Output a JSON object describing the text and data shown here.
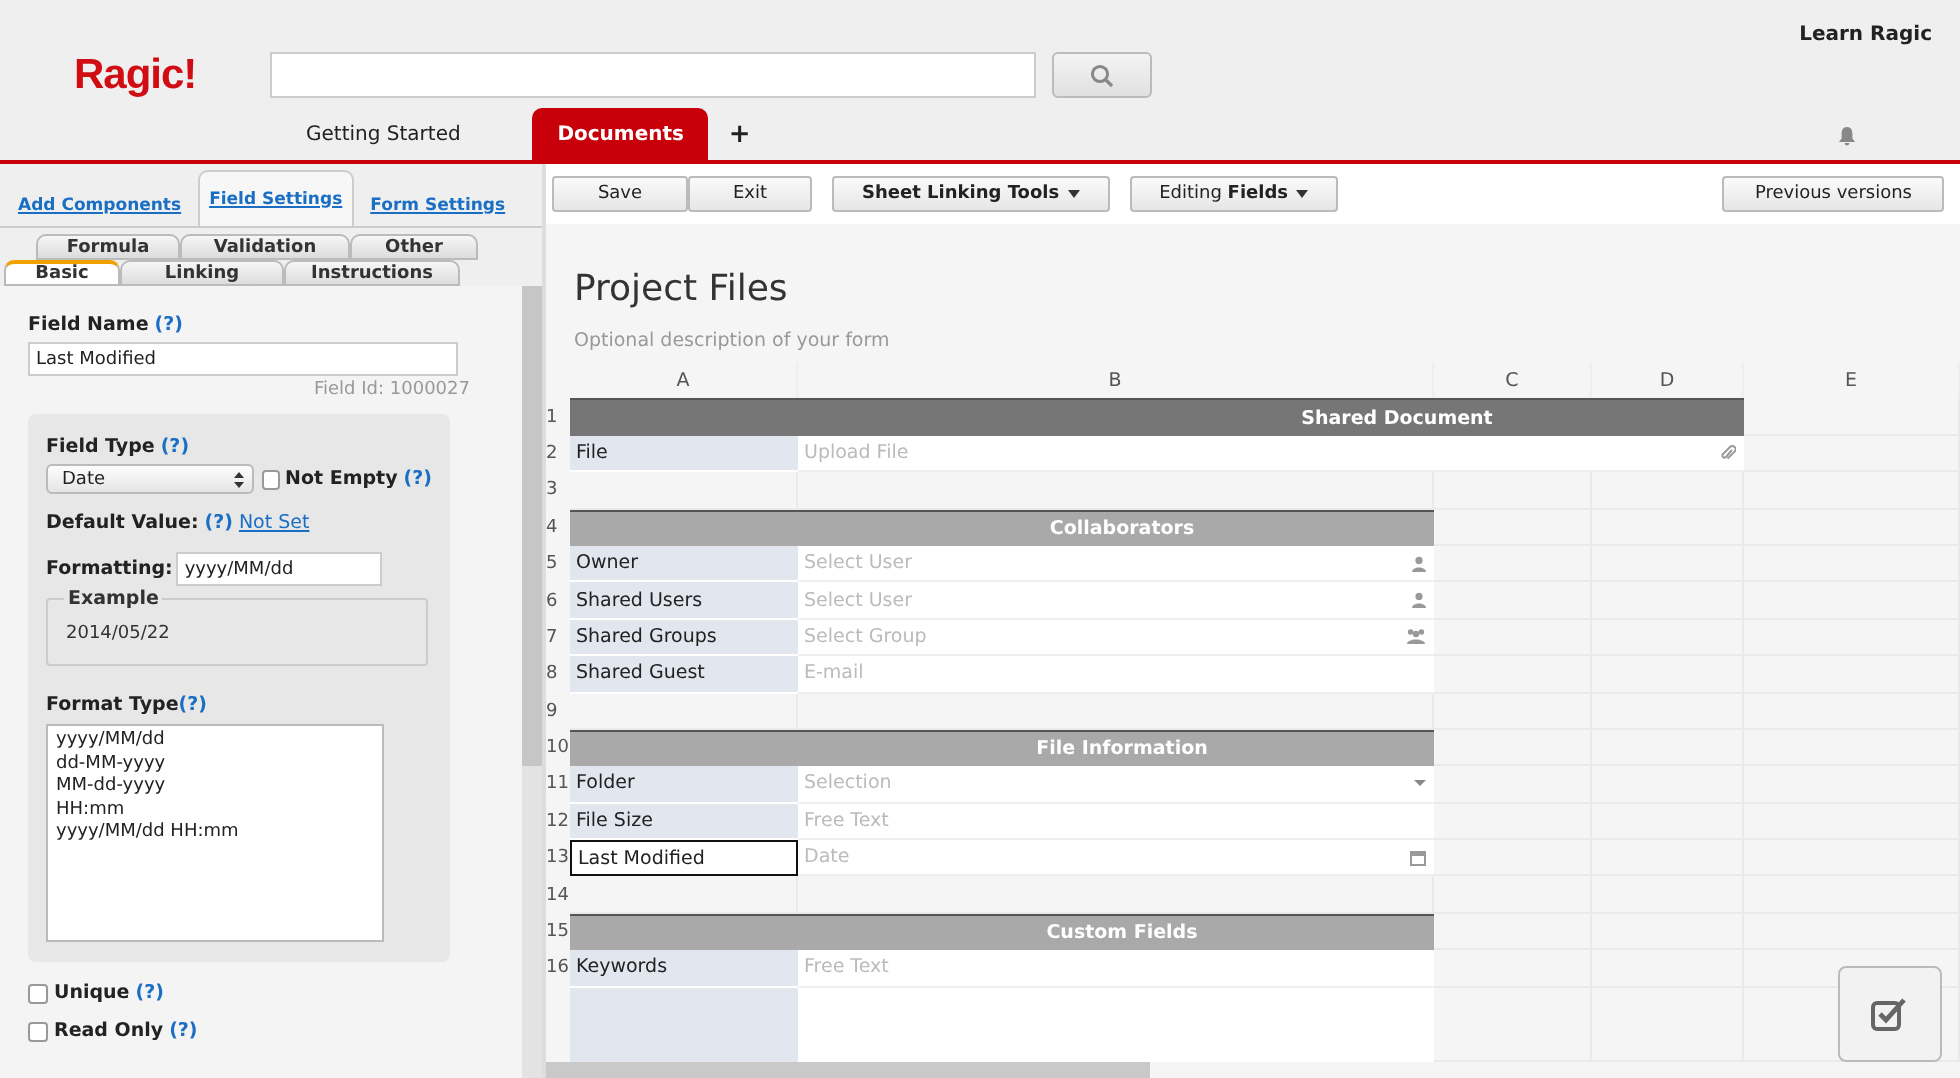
{
  "header": {
    "logo": "Ragic!",
    "learn_link": "Learn Ragic",
    "tabs": [
      {
        "label": "Getting Started",
        "selected": false
      },
      {
        "label": "Documents",
        "selected": true
      }
    ],
    "add_tab": "+"
  },
  "left_panel": {
    "tabs": [
      {
        "label": "Add Components",
        "selected": false
      },
      {
        "label": "Field Settings",
        "selected": true
      },
      {
        "label": "Form Settings",
        "selected": false
      }
    ],
    "subtabs_back": [
      {
        "label": "Formula",
        "selected": false
      },
      {
        "label": "Validation",
        "selected": false
      },
      {
        "label": "Other",
        "selected": false
      }
    ],
    "subtabs_front": [
      {
        "label": "Basic",
        "selected": true
      },
      {
        "label": "Linking",
        "selected": false
      },
      {
        "label": "Instructions",
        "selected": false
      }
    ],
    "field_name_label": "Field Name",
    "help": "(?)",
    "field_name": "Last Modified",
    "field_id": "Field Id: 1000027",
    "field_type_label": "Field Type",
    "field_type": "Date",
    "not_empty": {
      "label": "Not Empty",
      "checked": false
    },
    "default_value_label": "Default Value:",
    "default_value": "Not Set",
    "formatting_label": "Formatting:",
    "formatting": "yyyy/MM/dd",
    "example_label": "Example",
    "example": "2014/05/22",
    "format_type_label": "Format Type",
    "format_types": [
      "yyyy/MM/dd",
      "dd-MM-yyyy",
      "MM-dd-yyyy",
      "HH:mm",
      "yyyy/MM/dd HH:mm"
    ],
    "options": [
      {
        "label": "Unique",
        "checked": false
      },
      {
        "label": "Read Only",
        "checked": false
      }
    ]
  },
  "toolbar": {
    "buttons": [
      {
        "label": "Save",
        "kind": "plain"
      },
      {
        "label": "Exit",
        "kind": "plain"
      },
      {
        "label": "Sheet Linking Tools",
        "kind": "menu"
      },
      {
        "label": "Editing **Fields**",
        "kind": "menu"
      }
    ],
    "history": "Previous versions"
  },
  "form": {
    "title": "Project Files",
    "description": "Optional description of your form",
    "columns": [
      "A",
      "B",
      "C",
      "D",
      "E"
    ],
    "rows": [
      {
        "number": "1",
        "kind": "banner",
        "title": "Shared Document"
      },
      {
        "number": "2",
        "kind": "file",
        "label": "File",
        "placeholder": "Upload File",
        "selected": false
      },
      {
        "number": "3",
        "kind": "blank"
      },
      {
        "number": "4",
        "kind": "section",
        "title": "Collaborators"
      },
      {
        "number": "5",
        "kind": "user",
        "label": "Owner",
        "placeholder": "Select User",
        "selected": false
      },
      {
        "number": "6",
        "kind": "user",
        "label": "Shared Users",
        "placeholder": "Select User",
        "selected": false
      },
      {
        "number": "7",
        "kind": "group",
        "label": "Shared Groups",
        "placeholder": "Select Group",
        "selected": false
      },
      {
        "number": "8",
        "kind": "email",
        "label": "Shared Guest",
        "placeholder": "E-mail",
        "selected": false
      },
      {
        "number": "9",
        "kind": "blank"
      },
      {
        "number": "10",
        "kind": "section",
        "title": "File Information"
      },
      {
        "number": "11",
        "kind": "select",
        "label": "Folder",
        "placeholder": "Selection",
        "selected": false
      },
      {
        "number": "12",
        "kind": "text",
        "label": "File Size",
        "placeholder": "Free Text",
        "selected": false
      },
      {
        "number": "13",
        "kind": "date",
        "label": "Last Modified",
        "placeholder": "Date",
        "selected": true
      },
      {
        "number": "14",
        "kind": "blank"
      },
      {
        "number": "15",
        "kind": "section",
        "title": "Custom Fields"
      },
      {
        "number": "16",
        "kind": "textarea",
        "label": "Keywords",
        "placeholder": "Free Text",
        "selected": false
      }
    ]
  }
}
